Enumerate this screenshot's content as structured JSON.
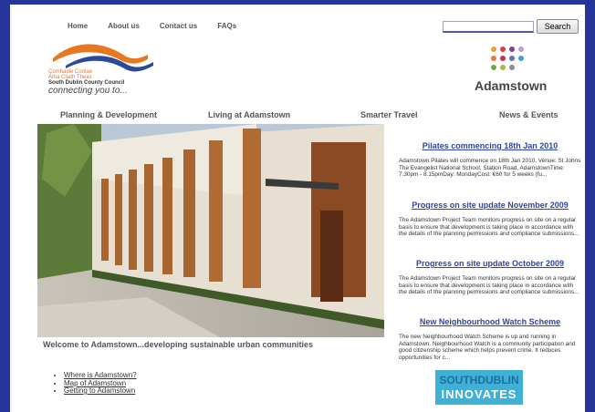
{
  "top_nav": {
    "items": [
      "Home",
      "About us",
      "Contact us",
      "FAQs"
    ]
  },
  "search": {
    "button_label": "Search",
    "placeholder": ""
  },
  "council": {
    "line1": "Comhairle Contae",
    "line2": "Átha Cliath Theas",
    "line3": "South Dublin County Council",
    "tagline": "connecting you to..."
  },
  "brand": {
    "name": "Adamstown",
    "dot_colors": [
      "#e9a33a",
      "#d9403f",
      "#8a3d93",
      "#b8a1cf",
      "#e37a35",
      "#c42f5d",
      "#6f6fb6",
      "#3aa3cf",
      "#6aa844",
      "#a6b84a",
      "#8e8e8e"
    ]
  },
  "main_nav": {
    "items": [
      "Planning & Development",
      "Living at Adamstown",
      "Smarter Travel",
      "News & Events"
    ]
  },
  "hero": {
    "caption": "Welcome to Adamstown...developing sustainable urban communities"
  },
  "news": [
    {
      "title": "Pilates commencing 18th Jan 2010",
      "body": "Adamstown Pilates will commence on 18th Jan 2010. Venue: St Johns The Evangelist National School, Station Road, AdamstownTime: 7.30pm - 8.15pmDay: MondayCost: €60 for 5 weeks (fu..."
    },
    {
      "title": "Progress on site update November 2009",
      "body": "The Adamstown Project Team monitors progress on site on a regular basis to ensure that development is taking place in accordance with the details of the planning permissions and compliance submissions..."
    },
    {
      "title": "Progress on site update October 2009",
      "body": "The Adamstown Project Team monitors progress on site on a regular basis to ensure that development is taking place in accordance with the details of the planning permissions and compliance submissions..."
    },
    {
      "title": "New Neighbourhood Watch Scheme",
      "body": "The new Neighbourhood Watch Scheme is up and running in Adamstown. Neighbourhood Watch is a community participation and good citizenship scheme which helps prevent crime. It reduces opportunities for c..."
    }
  ],
  "quick_links": [
    "Where is Adamstown?",
    "Map of Adamstown",
    "Getting to Adamstown"
  ],
  "banner": {
    "line1": "SOUTHDUBLIN",
    "line2": "INNOVATES"
  }
}
